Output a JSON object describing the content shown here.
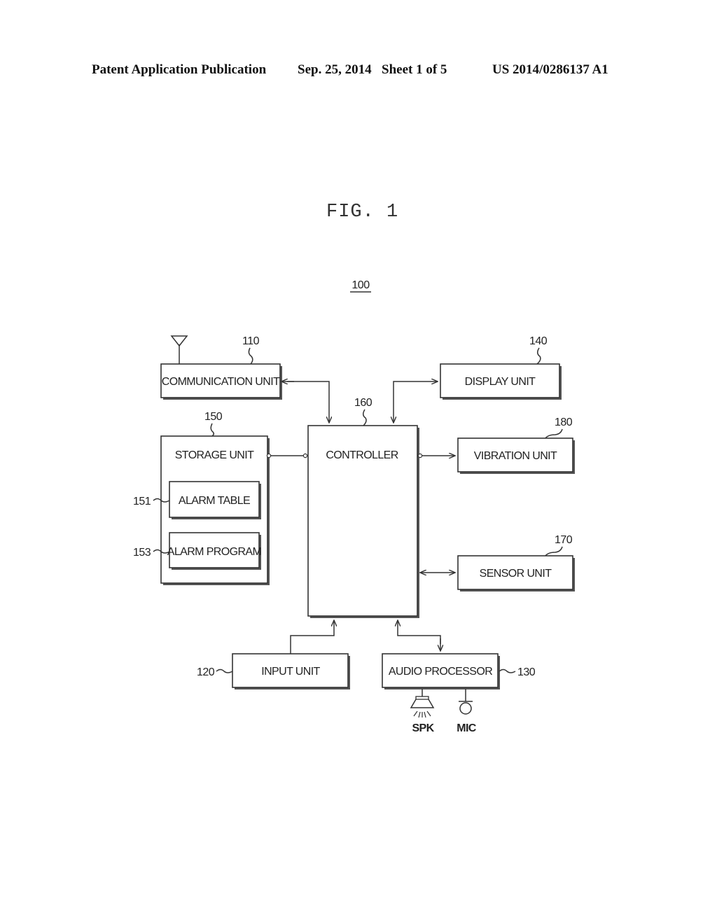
{
  "header": {
    "publication": "Patent Application Publication",
    "date": "Sep. 25, 2014",
    "sheet": "Sheet 1 of 5",
    "number": "US 2014/0286137 A1"
  },
  "figure": {
    "title": "FIG. 1",
    "device_ref": "100",
    "blocks": {
      "communication": {
        "label": "COMMUNICATION UNIT",
        "ref": "110"
      },
      "display": {
        "label": "DISPLAY UNIT",
        "ref": "140"
      },
      "controller": {
        "label": "CONTROLLER",
        "ref": "160"
      },
      "storage": {
        "label": "STORAGE UNIT",
        "ref": "150"
      },
      "alarm_table": {
        "label": "ALARM TABLE",
        "ref": "151"
      },
      "alarm_program": {
        "label": "ALARM PROGRAM",
        "ref": "153"
      },
      "vibration": {
        "label": "VIBRATION UNIT",
        "ref": "180"
      },
      "sensor": {
        "label": "SENSOR UNIT",
        "ref": "170"
      },
      "input": {
        "label": "INPUT UNIT",
        "ref": "120"
      },
      "audio": {
        "label": "AUDIO PROCESSOR",
        "ref": "130"
      }
    },
    "peripherals": {
      "speaker": "SPK",
      "microphone": "MIC"
    },
    "icons": [
      "antenna-icon",
      "speaker-icon",
      "microphone-icon"
    ]
  }
}
